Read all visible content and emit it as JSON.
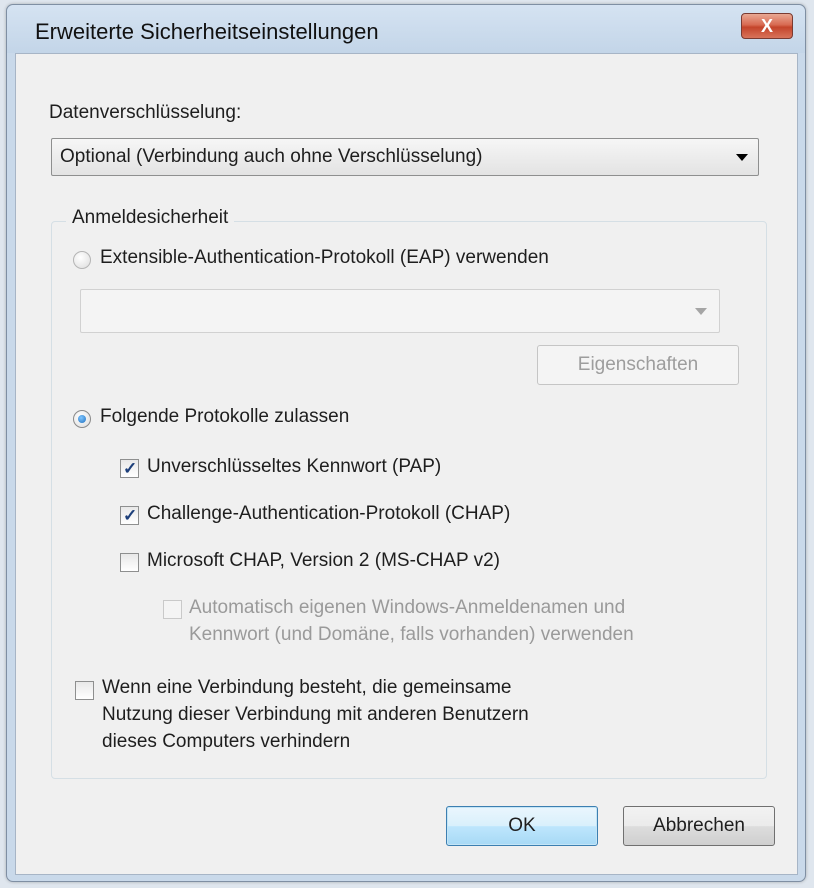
{
  "window": {
    "title": "Erweiterte Sicherheitseinstellungen",
    "close_label": "X"
  },
  "encryption": {
    "label": "Datenverschlüsselung:",
    "selected": "Optional (Verbindung auch ohne Verschlüsselung)"
  },
  "login_security": {
    "group_label": "Anmeldesicherheit",
    "eap_radio_label": "Extensible-Authentication-Protokoll (EAP) verwenden",
    "eap_radio_checked": false,
    "eap_combo_value": "",
    "properties_button": "Eigenschaften",
    "protocols_radio_label": "Folgende Protokolle zulassen",
    "protocols_radio_checked": true,
    "pap_label": "Unverschlüsseltes Kennwort (PAP)",
    "pap_checked": true,
    "chap_label": "Challenge-Authentication-Protokoll (CHAP)",
    "chap_checked": true,
    "mschap_label": "Microsoft CHAP, Version 2 (MS-CHAP v2)",
    "mschap_checked": false,
    "auto_login_label_line1": "Automatisch eigenen Windows-Anmeldenamen und",
    "auto_login_label_line2": "Kennwort (und Domäne, falls vorhanden) verwenden",
    "auto_login_checked": false,
    "share_label_line1": "Wenn eine Verbindung besteht, die gemeinsame",
    "share_label_line2": "Nutzung dieser Verbindung mit anderen Benutzern",
    "share_label_line3": "dieses Computers verhindern",
    "share_checked": false
  },
  "buttons": {
    "ok": "OK",
    "cancel": "Abbrechen"
  },
  "check_glyph": "✓"
}
